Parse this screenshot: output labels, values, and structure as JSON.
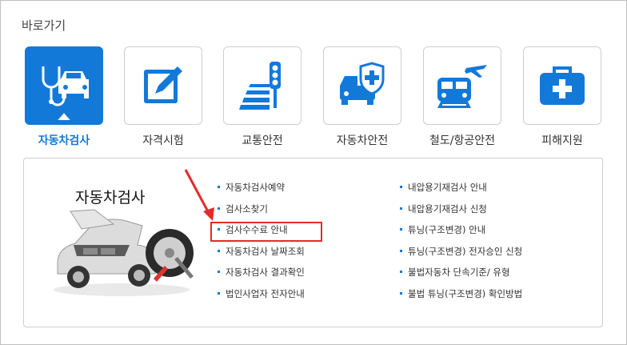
{
  "section_title": "바로가기",
  "tiles": [
    {
      "label": "자동차검사",
      "icon": "car-stethoscope-icon",
      "active": true
    },
    {
      "label": "자격시험",
      "icon": "edit-pencil-icon",
      "active": false
    },
    {
      "label": "교통안전",
      "icon": "traffic-light-road-icon",
      "active": false
    },
    {
      "label": "자동차안전",
      "icon": "car-shield-icon",
      "active": false
    },
    {
      "label": "철도/항공안전",
      "icon": "train-plane-icon",
      "active": false
    },
    {
      "label": "피해지원",
      "icon": "first-aid-kit-icon",
      "active": false
    }
  ],
  "panel": {
    "title": "자동차검사",
    "image": "car-inspection-illustration",
    "left_links": [
      "자동차검사예약",
      "검사소찾기",
      "검사수수료 안내",
      "자동차검사 날짜조회",
      "자동차검사 결과확인",
      "법인사업자 전자안내"
    ],
    "right_links": [
      "내압용기재검사 안내",
      "내압용기재검사 신청",
      "튜닝(구조변경) 안내",
      "튜닝(구조변경) 전자승인 신청",
      "불법자동차 단속기준/ 유형",
      "불법 튜닝(구조변경) 확인방법"
    ],
    "highlighted_link": "검사수수료 안내"
  },
  "colors": {
    "accent": "#1379d9",
    "annotation": "#e52a2a"
  }
}
